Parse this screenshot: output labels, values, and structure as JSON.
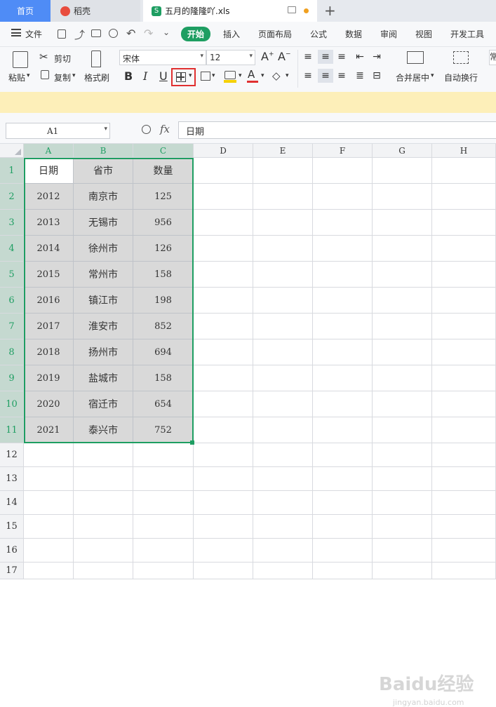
{
  "tabs": {
    "home": "首页",
    "docer": "稻壳",
    "file": "五月的隆隆吖.xls"
  },
  "menu": {
    "file": "文件",
    "items": [
      "开始",
      "插入",
      "页面布局",
      "公式",
      "数据",
      "审阅",
      "视图",
      "开发工具"
    ]
  },
  "toolbar": {
    "paste": "粘贴",
    "cut": "剪切",
    "copy": "复制",
    "format_painter": "格式刷",
    "font_name": "宋体",
    "font_size": "12",
    "bold": "B",
    "italic": "I",
    "underline": "U",
    "font_color_letter": "A",
    "merge_center": "合并居中",
    "wrap_text": "自动换行",
    "overflow": "常"
  },
  "formula_bar": {
    "cell_ref": "A1",
    "fx": "fx",
    "content": "日期"
  },
  "columns": [
    "A",
    "B",
    "C",
    "D",
    "E",
    "F",
    "G",
    "H"
  ],
  "rows": [
    "1",
    "2",
    "3",
    "4",
    "5",
    "6",
    "7",
    "8",
    "9",
    "10",
    "11",
    "12",
    "13",
    "14",
    "15",
    "16",
    "17"
  ],
  "table": {
    "headers": [
      "日期",
      "省市",
      "数量"
    ],
    "rows": [
      [
        "2012",
        "南京市",
        "125"
      ],
      [
        "2013",
        "无锡市",
        "956"
      ],
      [
        "2014",
        "徐州市",
        "126"
      ],
      [
        "2015",
        "常州市",
        "158"
      ],
      [
        "2016",
        "镇江市",
        "198"
      ],
      [
        "2017",
        "淮安市",
        "852"
      ],
      [
        "2018",
        "扬州市",
        "694"
      ],
      [
        "2019",
        "盐城市",
        "158"
      ],
      [
        "2020",
        "宿迁市",
        "654"
      ],
      [
        "2021",
        "泰兴市",
        "752"
      ]
    ]
  },
  "watermark": {
    "text": "Baidu经验",
    "sub": "jingyan.baidu.com"
  },
  "colors": {
    "accent": "#1e9e62",
    "tab_home": "#4f8cf6",
    "banner": "#fdefb9",
    "highlight_box": "#e03030"
  }
}
